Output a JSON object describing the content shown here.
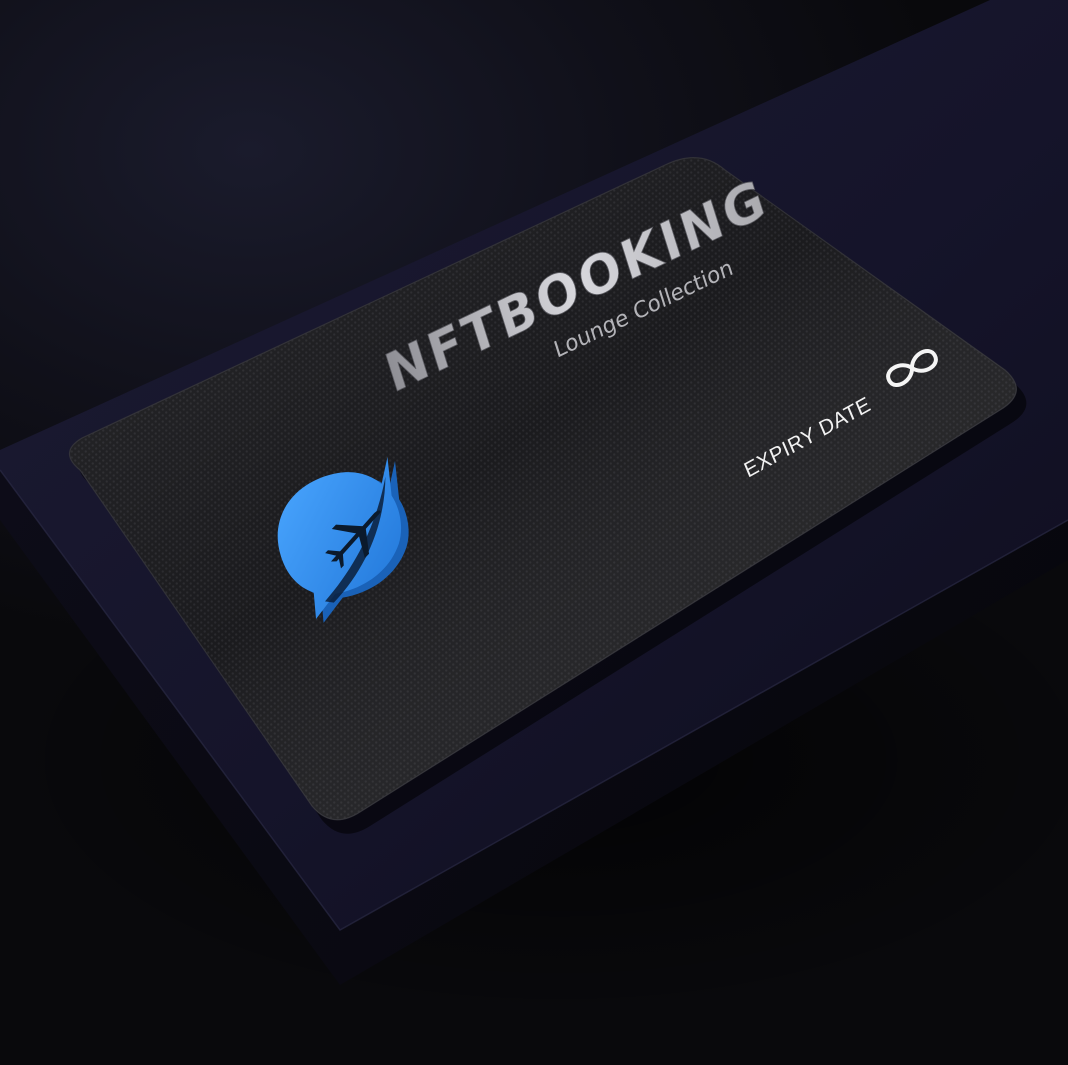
{
  "card": {
    "title": "NFTBOOKING",
    "subtitle": "Lounge Collection",
    "expiry_label": "EXPIRY DATE",
    "expiry_icon": "infinity-icon",
    "logo_icon": "airplane-chat-bubble-logo-icon"
  },
  "colors": {
    "background": "#0a0a0e",
    "box": "#16152a",
    "card": "#1a1a1d",
    "logo_blue": "#2f8fee",
    "logo_blue_dark": "#1a62b8",
    "text_silver": "#bfbfc4",
    "text_white": "#f2f2f2"
  }
}
